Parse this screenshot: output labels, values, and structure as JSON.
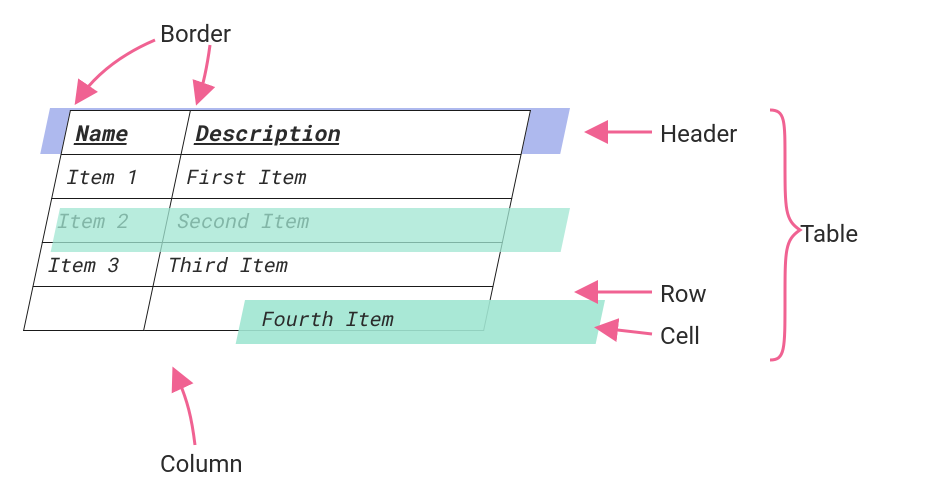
{
  "labels": {
    "border": "Border",
    "header": "Header",
    "row": "Row",
    "cell": "Cell",
    "table": "Table",
    "column": "Column"
  },
  "table": {
    "headers": {
      "name": "Name",
      "description": "Description"
    },
    "rows": [
      {
        "name": "Item 1",
        "description": "First Item"
      },
      {
        "name": "Item 2",
        "description": "Second Item"
      },
      {
        "name": "Item 3",
        "description": "Third Item"
      },
      {
        "name": "",
        "description": ""
      }
    ]
  },
  "floating_cell_text": "Fourth Item",
  "colors": {
    "arrow_pink": "#f06292",
    "header_highlight": "#8a9be0",
    "row_highlight": "#a8e6d4"
  }
}
